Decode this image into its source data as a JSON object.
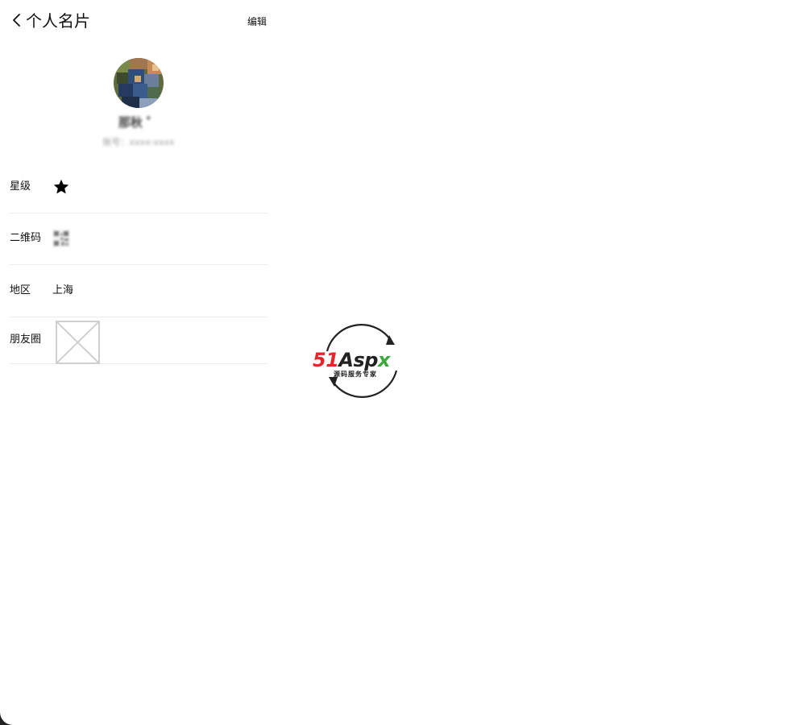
{
  "header": {
    "title": "个人名片",
    "edit_label": "编辑",
    "back_icon": "chevron-left-icon"
  },
  "profile": {
    "nickname": "那秋 ゜",
    "account_id": "账号：xxxx-xxxx"
  },
  "rows": [
    {
      "label": "星级",
      "value_icon": "star-icon"
    },
    {
      "label": "二维码",
      "value_icon": "qr-code-icon"
    },
    {
      "label": "地区",
      "value": "上海"
    },
    {
      "label": "朋友圈",
      "value_icon": "image-placeholder-icon"
    }
  ],
  "watermark": {
    "brand_red": "51",
    "brand_dark": "As",
    "brand_dark2": "p",
    "brand_green": "x",
    "tagline": "源码服务专家",
    "colors": {
      "red": "#e4262b",
      "green": "#3aa93a",
      "dark": "#222222"
    }
  }
}
